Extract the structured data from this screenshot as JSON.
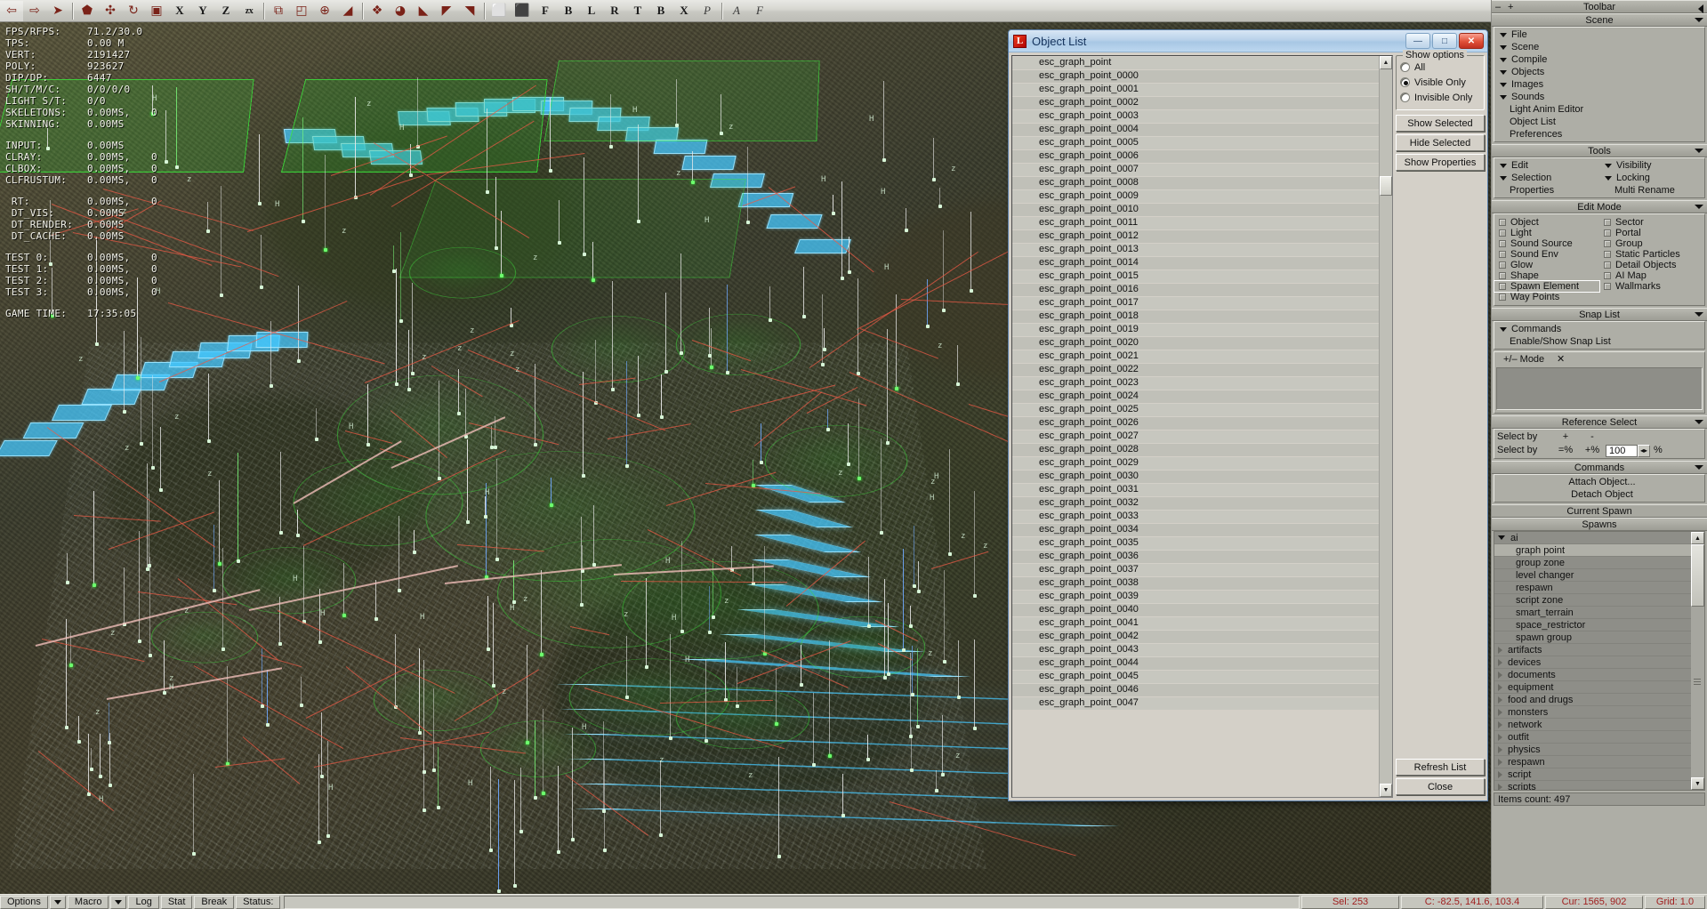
{
  "toolbar": {
    "title": "Toolbar",
    "buttons": [
      {
        "name": "back-arrow-icon",
        "glyph": "⇦",
        "kind": "icon"
      },
      {
        "name": "forward-arrow-icon",
        "glyph": "⇨",
        "kind": "icon"
      },
      {
        "name": "select-cursor-icon",
        "glyph": "➤",
        "kind": "icon"
      },
      {
        "sep": true
      },
      {
        "name": "move-tool-icon",
        "glyph": "⬟",
        "kind": "icon"
      },
      {
        "name": "rotate-tool-icon",
        "glyph": "✣",
        "kind": "icon"
      },
      {
        "name": "scale-tool-icon",
        "glyph": "↻",
        "kind": "icon"
      },
      {
        "name": "box-tool-icon",
        "glyph": "▣",
        "kind": "icon"
      },
      {
        "name": "axis-x-button",
        "glyph": "X",
        "kind": "letter"
      },
      {
        "name": "axis-y-button",
        "glyph": "Y",
        "kind": "letter"
      },
      {
        "name": "axis-z-button",
        "glyph": "Z",
        "kind": "letter"
      },
      {
        "name": "axis-zx-button",
        "glyph": "zx",
        "kind": "letter-small"
      },
      {
        "sep": true
      },
      {
        "name": "snap-to-object-icon",
        "glyph": "⧉",
        "kind": "icon"
      },
      {
        "name": "align-icon",
        "glyph": "◰",
        "kind": "icon"
      },
      {
        "name": "pivot-icon",
        "glyph": "⊕",
        "kind": "icon"
      },
      {
        "name": "paint-icon",
        "glyph": "◢",
        "kind": "icon"
      },
      {
        "sep": true
      },
      {
        "name": "object-copy-icon",
        "glyph": "❖",
        "kind": "icon"
      },
      {
        "name": "sphere-icon",
        "glyph": "◕",
        "kind": "icon"
      },
      {
        "name": "brush-icon",
        "glyph": "◣",
        "kind": "icon"
      },
      {
        "name": "eraser-icon",
        "glyph": "◤",
        "kind": "icon"
      },
      {
        "name": "brush2-icon",
        "glyph": "◥",
        "kind": "icon"
      },
      {
        "sep": true
      },
      {
        "name": "grid-snap-icon",
        "glyph": "⬜",
        "kind": "icon"
      },
      {
        "name": "grid-snap2-icon",
        "glyph": "⬛",
        "kind": "icon"
      },
      {
        "name": "filter-f-button",
        "glyph": "F",
        "kind": "letter"
      },
      {
        "name": "filter-b-button",
        "glyph": "B",
        "kind": "letter"
      },
      {
        "name": "filter-l-button",
        "glyph": "L",
        "kind": "letter"
      },
      {
        "name": "filter-r-button",
        "glyph": "R",
        "kind": "letter"
      },
      {
        "name": "filter-t-button",
        "glyph": "T",
        "kind": "letter"
      },
      {
        "name": "filter-b2-button",
        "glyph": "B",
        "kind": "letter"
      },
      {
        "name": "filter-x-button",
        "glyph": "X",
        "kind": "letter"
      },
      {
        "name": "perspective-p-button",
        "glyph": "P",
        "kind": "letter-italic"
      },
      {
        "sep": true
      },
      {
        "name": "anim-a-button",
        "glyph": "A",
        "kind": "letter-italic"
      },
      {
        "name": "frame-f-button",
        "glyph": "F",
        "kind": "letter-italic"
      }
    ]
  },
  "stats": {
    "rows": [
      {
        "key": "FPS/RFPS:",
        "v1": "71.2/30.0",
        "v2": ""
      },
      {
        "key": "TPS:",
        "v1": "0.00 M",
        "v2": ""
      },
      {
        "key": "VERT:",
        "v1": "2191427",
        "v2": ""
      },
      {
        "key": "POLY:",
        "v1": "923627",
        "v2": ""
      },
      {
        "key": "DIP/DP:",
        "v1": "6447",
        "v2": ""
      },
      {
        "key": "SH/T/M/C:",
        "v1": "0/0/0/0",
        "v2": ""
      },
      {
        "key": "LIGHT S/T:",
        "v1": "0/0",
        "v2": ""
      },
      {
        "key": "SKELETONS:",
        "v1": "0.00MS,",
        "v2": "0"
      },
      {
        "key": "SKINNING:",
        "v1": "0.00MS",
        "v2": ""
      },
      {
        "gap": true
      },
      {
        "key": "INPUT:",
        "v1": "0.00MS",
        "v2": ""
      },
      {
        "key": "CLRAY:",
        "v1": "0.00MS,",
        "v2": "0"
      },
      {
        "key": "CLBOX:",
        "v1": "0.00MS,",
        "v2": "0"
      },
      {
        "key": "CLFRUSTUM:",
        "v1": "0.00MS,",
        "v2": "0"
      },
      {
        "gap": true
      },
      {
        "key": " RT:",
        "v1": "0.00MS,",
        "v2": "0"
      },
      {
        "key": " DT_VIS:",
        "v1": "0.00MS",
        "v2": ""
      },
      {
        "key": " DT_RENDER:",
        "v1": "0.00MS",
        "v2": ""
      },
      {
        "key": " DT_CACHE:",
        "v1": "0.00MS",
        "v2": ""
      },
      {
        "gap": true
      },
      {
        "key": "TEST 0:",
        "v1": "0.00MS,",
        "v2": "0"
      },
      {
        "key": "TEST 1:",
        "v1": "0.00MS,",
        "v2": "0"
      },
      {
        "key": "TEST 2:",
        "v1": "0.00MS,",
        "v2": "0"
      },
      {
        "key": "TEST 3:",
        "v1": "0.00MS,",
        "v2": "0"
      },
      {
        "gap": true
      },
      {
        "key": "GAME TIME:",
        "v1": "17:35:05",
        "v2": ""
      }
    ]
  },
  "object_list": {
    "title": "Object List",
    "icon": "L",
    "window_buttons": [
      {
        "name": "minimize-button",
        "glyph": "—"
      },
      {
        "name": "restore-button",
        "glyph": "□"
      },
      {
        "name": "close-button",
        "glyph": "✕"
      }
    ],
    "items": [
      "esc_graph_point",
      "esc_graph_point_0000",
      "esc_graph_point_0001",
      "esc_graph_point_0002",
      "esc_graph_point_0003",
      "esc_graph_point_0004",
      "esc_graph_point_0005",
      "esc_graph_point_0006",
      "esc_graph_point_0007",
      "esc_graph_point_0008",
      "esc_graph_point_0009",
      "esc_graph_point_0010",
      "esc_graph_point_0011",
      "esc_graph_point_0012",
      "esc_graph_point_0013",
      "esc_graph_point_0014",
      "esc_graph_point_0015",
      "esc_graph_point_0016",
      "esc_graph_point_0017",
      "esc_graph_point_0018",
      "esc_graph_point_0019",
      "esc_graph_point_0020",
      "esc_graph_point_0021",
      "esc_graph_point_0022",
      "esc_graph_point_0023",
      "esc_graph_point_0024",
      "esc_graph_point_0025",
      "esc_graph_point_0026",
      "esc_graph_point_0027",
      "esc_graph_point_0028",
      "esc_graph_point_0029",
      "esc_graph_point_0030",
      "esc_graph_point_0031",
      "esc_graph_point_0032",
      "esc_graph_point_0033",
      "esc_graph_point_0034",
      "esc_graph_point_0035",
      "esc_graph_point_0036",
      "esc_graph_point_0037",
      "esc_graph_point_0038",
      "esc_graph_point_0039",
      "esc_graph_point_0040",
      "esc_graph_point_0041",
      "esc_graph_point_0042",
      "esc_graph_point_0043",
      "esc_graph_point_0044",
      "esc_graph_point_0045",
      "esc_graph_point_0046",
      "esc_graph_point_0047"
    ],
    "show_options": {
      "legend": "Show options",
      "options": [
        {
          "label": "All",
          "selected": false
        },
        {
          "label": "Visible Only",
          "selected": true
        },
        {
          "label": "Invisible Only",
          "selected": false
        }
      ]
    },
    "buttons": {
      "show_selected": "Show Selected",
      "hide_selected": "Hide Selected",
      "show_properties": "Show Properties",
      "refresh_list": "Refresh List",
      "close": "Close"
    }
  },
  "sidebar": {
    "toolbar_bar": {
      "title": "Toolbar",
      "minus": "–",
      "plus": "+"
    },
    "scene": {
      "title": "Scene",
      "items": [
        {
          "label": "File",
          "expandable": true
        },
        {
          "label": "Scene",
          "expandable": true
        },
        {
          "label": "Compile",
          "expandable": true
        },
        {
          "label": "Objects",
          "expandable": true
        },
        {
          "label": "Images",
          "expandable": true
        },
        {
          "label": "Sounds",
          "expandable": true
        },
        {
          "label": "Light Anim Editor",
          "expandable": false
        },
        {
          "label": "Object List",
          "expandable": false
        },
        {
          "label": "Preferences",
          "expandable": false
        }
      ]
    },
    "tools": {
      "title": "Tools",
      "left": [
        {
          "label": "Edit",
          "expandable": true
        },
        {
          "label": "Selection",
          "expandable": true
        },
        {
          "label": "Properties",
          "expandable": false
        }
      ],
      "right": [
        {
          "label": "Visibility",
          "expandable": true
        },
        {
          "label": "Locking",
          "expandable": true
        },
        {
          "label": "Multi Rename",
          "expandable": false
        }
      ]
    },
    "edit_mode": {
      "title": "Edit Mode",
      "left": [
        {
          "label": "Object",
          "checked": false
        },
        {
          "label": "Light",
          "checked": false
        },
        {
          "label": "Sound Source",
          "checked": false
        },
        {
          "label": "Sound Env",
          "checked": false
        },
        {
          "label": "Glow",
          "checked": false
        },
        {
          "label": "Shape",
          "checked": false
        },
        {
          "label": "Spawn Element",
          "checked": false,
          "focused": true
        },
        {
          "label": "Way Points",
          "checked": false
        }
      ],
      "right": [
        {
          "label": "Sector",
          "checked": false
        },
        {
          "label": "Portal",
          "checked": false
        },
        {
          "label": "Group",
          "checked": false
        },
        {
          "label": "Static Particles",
          "checked": false
        },
        {
          "label": "Detail Objects",
          "checked": false
        },
        {
          "label": "AI Map",
          "checked": false
        },
        {
          "label": "Wallmarks",
          "checked": false
        }
      ]
    },
    "snap_list": {
      "title": "Snap List",
      "commands_label": "Commands",
      "enable_show": "Enable/Show Snap List",
      "mode_label": "+/– Mode",
      "mode_value": "✕"
    },
    "reference_select": {
      "title": "Reference Select",
      "rows": [
        {
          "label": "Select by",
          "op1": "+",
          "op2": "-"
        },
        {
          "label": "Select by",
          "op1": "=%",
          "op2": "+%",
          "value": "100",
          "unit": "%"
        }
      ]
    },
    "commands": {
      "title": "Commands",
      "items": [
        "Attach Object...",
        "Detach Object"
      ]
    },
    "current_spawn": {
      "title": "Current Spawn"
    },
    "spawns": {
      "title": "Spawns",
      "items": [
        {
          "label": "ai",
          "level": 0,
          "expanded": true
        },
        {
          "label": "graph point",
          "level": 1,
          "selected": true
        },
        {
          "label": "group zone",
          "level": 1
        },
        {
          "label": "level changer",
          "level": 1
        },
        {
          "label": "respawn",
          "level": 1
        },
        {
          "label": "script zone",
          "level": 1
        },
        {
          "label": "smart_terrain",
          "level": 1
        },
        {
          "label": "space_restrictor",
          "level": 1
        },
        {
          "label": "spawn group",
          "level": 1
        },
        {
          "label": "artifacts",
          "level": 0,
          "expanded": false
        },
        {
          "label": "devices",
          "level": 0,
          "expanded": false
        },
        {
          "label": "documents",
          "level": 0,
          "expanded": false
        },
        {
          "label": "equipment",
          "level": 0,
          "expanded": false
        },
        {
          "label": "food and drugs",
          "level": 0,
          "expanded": false
        },
        {
          "label": "monsters",
          "level": 0,
          "expanded": false
        },
        {
          "label": "network",
          "level": 0,
          "expanded": false
        },
        {
          "label": "outfit",
          "level": 0,
          "expanded": false
        },
        {
          "label": "physics",
          "level": 0,
          "expanded": false
        },
        {
          "label": "respawn",
          "level": 0,
          "expanded": false
        },
        {
          "label": "script",
          "level": 0,
          "expanded": false
        },
        {
          "label": "scripts",
          "level": 0,
          "expanded": false
        }
      ]
    },
    "items_count": "Items count: 497"
  },
  "statusbar": {
    "options": "Options",
    "macro": "Macro",
    "log": "Log",
    "stat": "Stat",
    "break": "Break",
    "status_label": "Status:",
    "status_value": "",
    "sel": "Sel: 253",
    "coords": "C: -82.5, 141.6, 103.4",
    "cursor": "Cur: 1565, 902",
    "grid": "Grid: 1.0"
  },
  "colors": {
    "dialog_title": "#a8c7e4",
    "panel": "#d4d0c8",
    "sidebar": "#aeaea6",
    "status_red": "#a02020",
    "selection_green": "#3cdc3c",
    "cyan_band": "#46c8ff"
  }
}
